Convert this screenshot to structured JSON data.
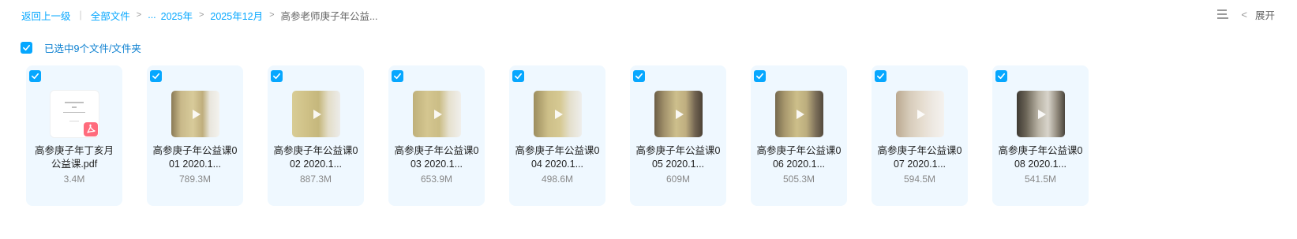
{
  "breadcrumb": {
    "back": "返回上一级",
    "all_files": "全部文件",
    "ellipsis": "...",
    "year": "2025年",
    "month": "2025年12月",
    "current": "高参老师庚子年公益..."
  },
  "toolbar": {
    "expand_label": "展开"
  },
  "selection": {
    "text": "已选中9个文件/文件夹"
  },
  "files": [
    {
      "name": "高参庚子年丁亥月\n公益课.pdf",
      "size": "3.4M",
      "type": "pdf"
    },
    {
      "name": "高参庚子年公益课0\n01 2020.1...",
      "size": "789.3M",
      "type": "video"
    },
    {
      "name": "高参庚子年公益课0\n02 2020.1...",
      "size": "887.3M",
      "type": "video"
    },
    {
      "name": "高参庚子年公益课0\n03 2020.1...",
      "size": "653.9M",
      "type": "video"
    },
    {
      "name": "高参庚子年公益课0\n04 2020.1...",
      "size": "498.6M",
      "type": "video"
    },
    {
      "name": "高参庚子年公益课0\n05 2020.1...",
      "size": "609M",
      "type": "video"
    },
    {
      "name": "高参庚子年公益课0\n06 2020.1...",
      "size": "505.3M",
      "type": "video"
    },
    {
      "name": "高参庚子年公益课0\n07 2020.1...",
      "size": "594.5M",
      "type": "video"
    },
    {
      "name": "高参庚子年公益课0\n08 2020.1...",
      "size": "541.5M",
      "type": "video"
    }
  ],
  "colors": {
    "accent": "#06a7ff",
    "card_bg": "#eff8ff",
    "pdf_red": "#ff6b7c"
  }
}
